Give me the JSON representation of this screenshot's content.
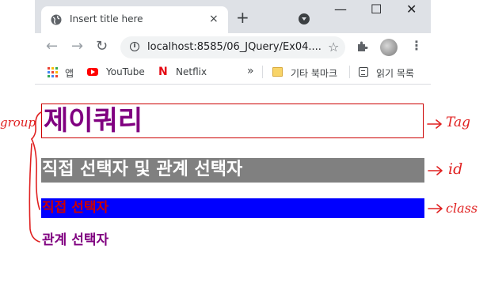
{
  "browser": {
    "tab_title": "Insert title here",
    "tab_close": "×",
    "new_tab": "+",
    "window_buttons": {
      "minimize": "—",
      "maximize": "☐",
      "close": "✕"
    },
    "nav": {
      "back": "←",
      "forward": "→",
      "reload": "↻"
    },
    "url": "localhost:8585/06_JQuery/Ex04....",
    "star": "☆",
    "menu": "⋮",
    "bookmarks": {
      "apps_label": "앱",
      "youtube_label": "YouTube",
      "netflix_label": "Netflix",
      "netflix_logo": "N",
      "more": "»",
      "other_label": "기타 북마크",
      "reading_label": "읽기 목록"
    },
    "icons": [
      "globe-icon",
      "info-icon",
      "star-icon",
      "puzzle-icon",
      "profile-avatar",
      "apps-icon",
      "youtube-icon",
      "netflix-icon",
      "folder-icon",
      "reading-list-icon"
    ]
  },
  "content": {
    "title": "제이쿼리",
    "id_heading": "직접 선택자 및 관계 선택자",
    "class_text": "직접 선택자",
    "relation_text": "관계 선택자"
  },
  "annotations": {
    "group": "group",
    "tag": "Tag",
    "id": "id",
    "class": "class",
    "color": "#e02020"
  },
  "colors": {
    "title_text": "#800080",
    "title_border": "#cc0000",
    "id_background": "#808080",
    "id_text": "#ffffff",
    "class_background": "#0000ff",
    "class_text": "#cc0000",
    "relation_text": "#800080"
  }
}
